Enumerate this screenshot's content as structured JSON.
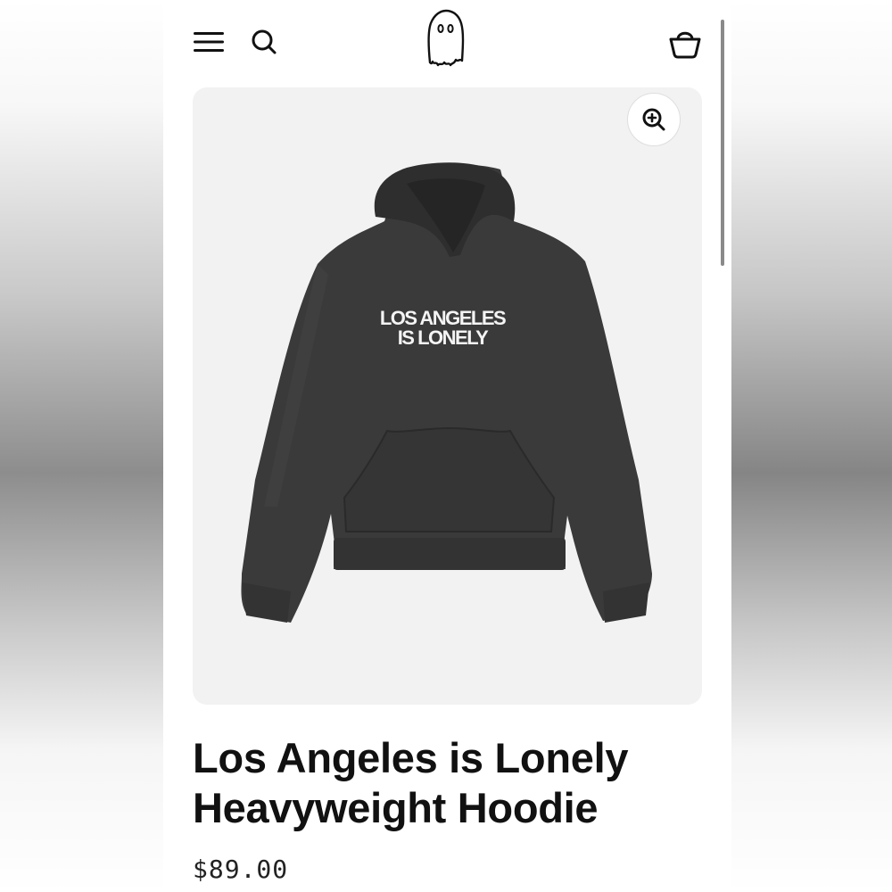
{
  "header": {
    "menu_icon": "hamburger-menu-icon",
    "search_icon": "search-icon",
    "logo_icon": "ghost-logo-icon",
    "cart_icon": "shopping-basket-icon"
  },
  "product": {
    "image": {
      "zoom_icon": "zoom-in-icon",
      "print_line1": "LOS ANGELES",
      "print_line2": "IS LONELY",
      "background_color": "#f2f2f2",
      "hoodie_color": "#3a3a3a"
    },
    "title": "Los Angeles is Lonely Heavyweight Hoodie",
    "price": "$89.00"
  }
}
